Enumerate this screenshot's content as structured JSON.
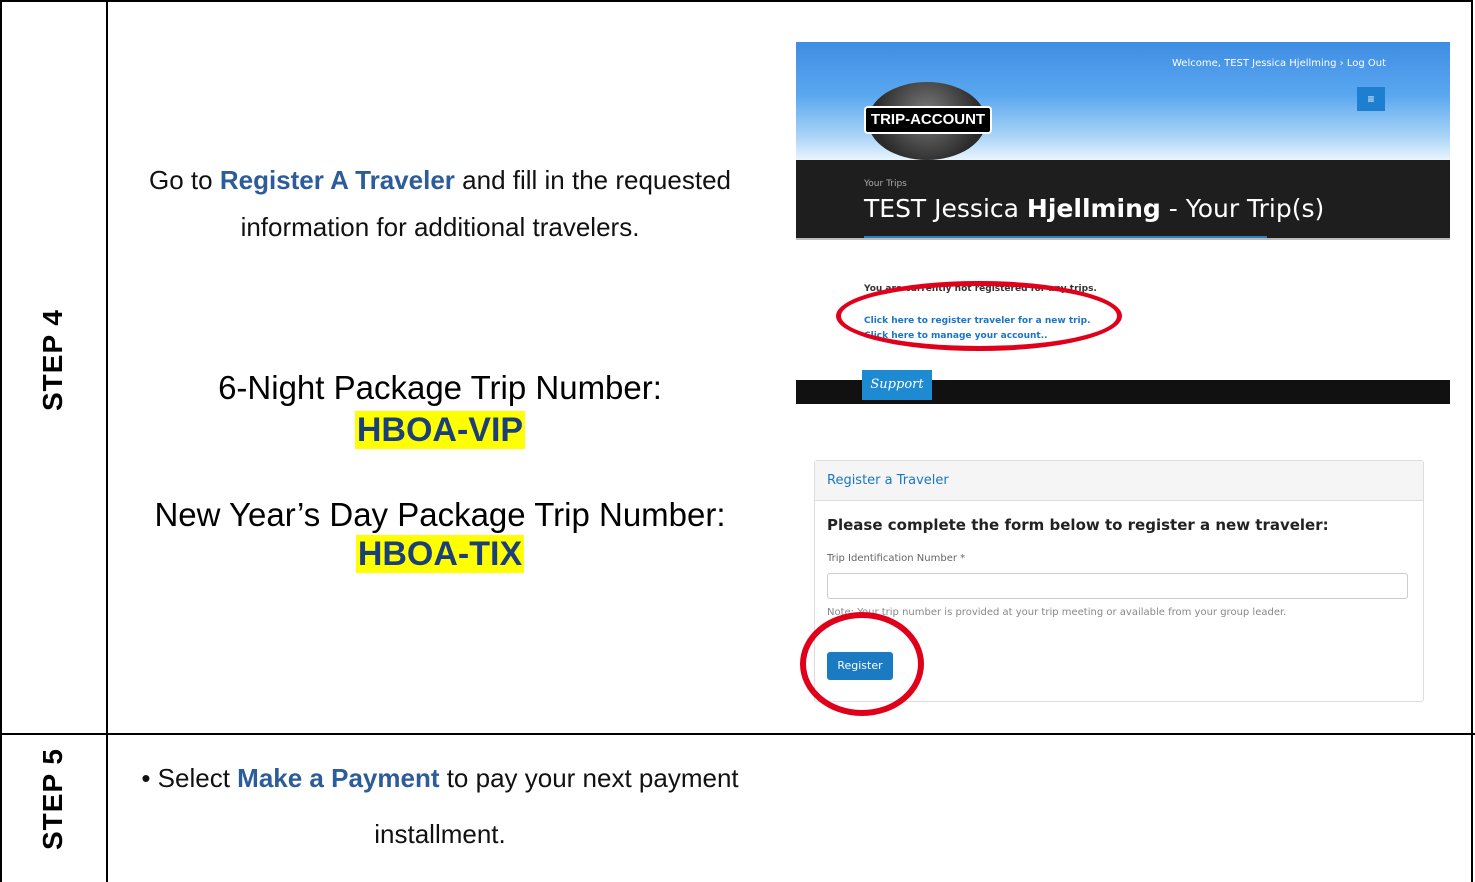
{
  "step4": {
    "label": "STEP 4",
    "instr_pre": "Go to ",
    "instr_link": "Register A Traveler",
    "instr_post": " and fill in the requested",
    "instr_line2": "information for additional travelers.",
    "pkg1_label": "6-Night Package Trip Number:",
    "pkg1_code": "HBOA-VIP",
    "pkg2_label": "New Year’s Day Package Trip Number:",
    "pkg2_code": "HBOA-TIX"
  },
  "screenshot1": {
    "logo_text": "TRIP-ACCOUNT",
    "welcome": "Welcome, TEST Jessica Hjellming   › Log Out",
    "menu_icon": "≡",
    "your_trips": "Your Trips",
    "heading_pre": "TEST Jessica ",
    "heading_bold": "Hjellming",
    "heading_post": " - Your Trip(s)",
    "not_registered": "You are currently not registered for any trips.",
    "link_register": "Click here to register traveler for a new trip.",
    "link_manage": "Click here to manage your account..",
    "support_tab": "Support"
  },
  "screenshot2": {
    "panel_title": "Register a Traveler",
    "form_title": "Please complete the form below to register a new traveler:",
    "field_label": "Trip Identification Number *",
    "field_value": "",
    "note": "Note: Your trip number is provided at your trip meeting or available from your group leader.",
    "register_button": "Register"
  },
  "step5": {
    "label": "STEP 5",
    "instr_pre": "• Select ",
    "instr_link": "Make a Payment",
    "instr_post": " to pay your next payment",
    "instr_line2": "installment."
  },
  "colors": {
    "accent_blue": "#2d5c9a",
    "highlight": "#ffff00",
    "annotation_red": "#e0001a"
  }
}
